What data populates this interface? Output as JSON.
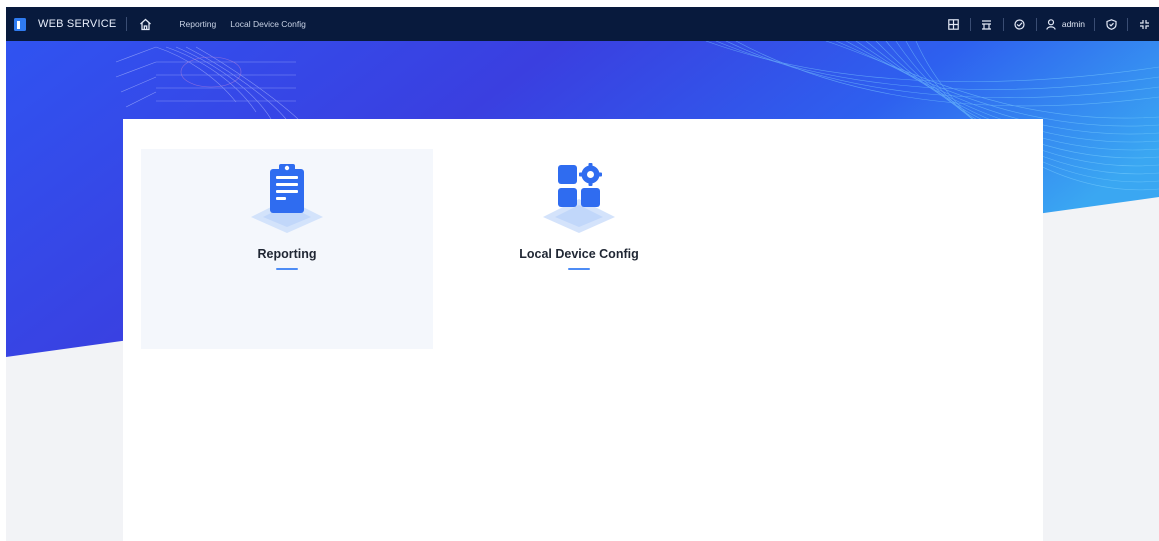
{
  "header": {
    "brand": "WEB SERVICE",
    "tabs": [
      {
        "label": "Reporting"
      },
      {
        "label": "Local Device Config"
      }
    ],
    "user": {
      "name": "admin"
    }
  },
  "main": {
    "tiles": [
      {
        "label": "Reporting",
        "icon": "clipboard-report-icon",
        "active": true
      },
      {
        "label": "Local Device Config",
        "icon": "device-config-icon",
        "active": false
      }
    ]
  },
  "colors": {
    "topbar": "#081a3d",
    "accent": "#3f7bf0",
    "hero_blue": "#2f55f3",
    "card": "#ffffff",
    "tile_active": "#f4f7fc"
  }
}
